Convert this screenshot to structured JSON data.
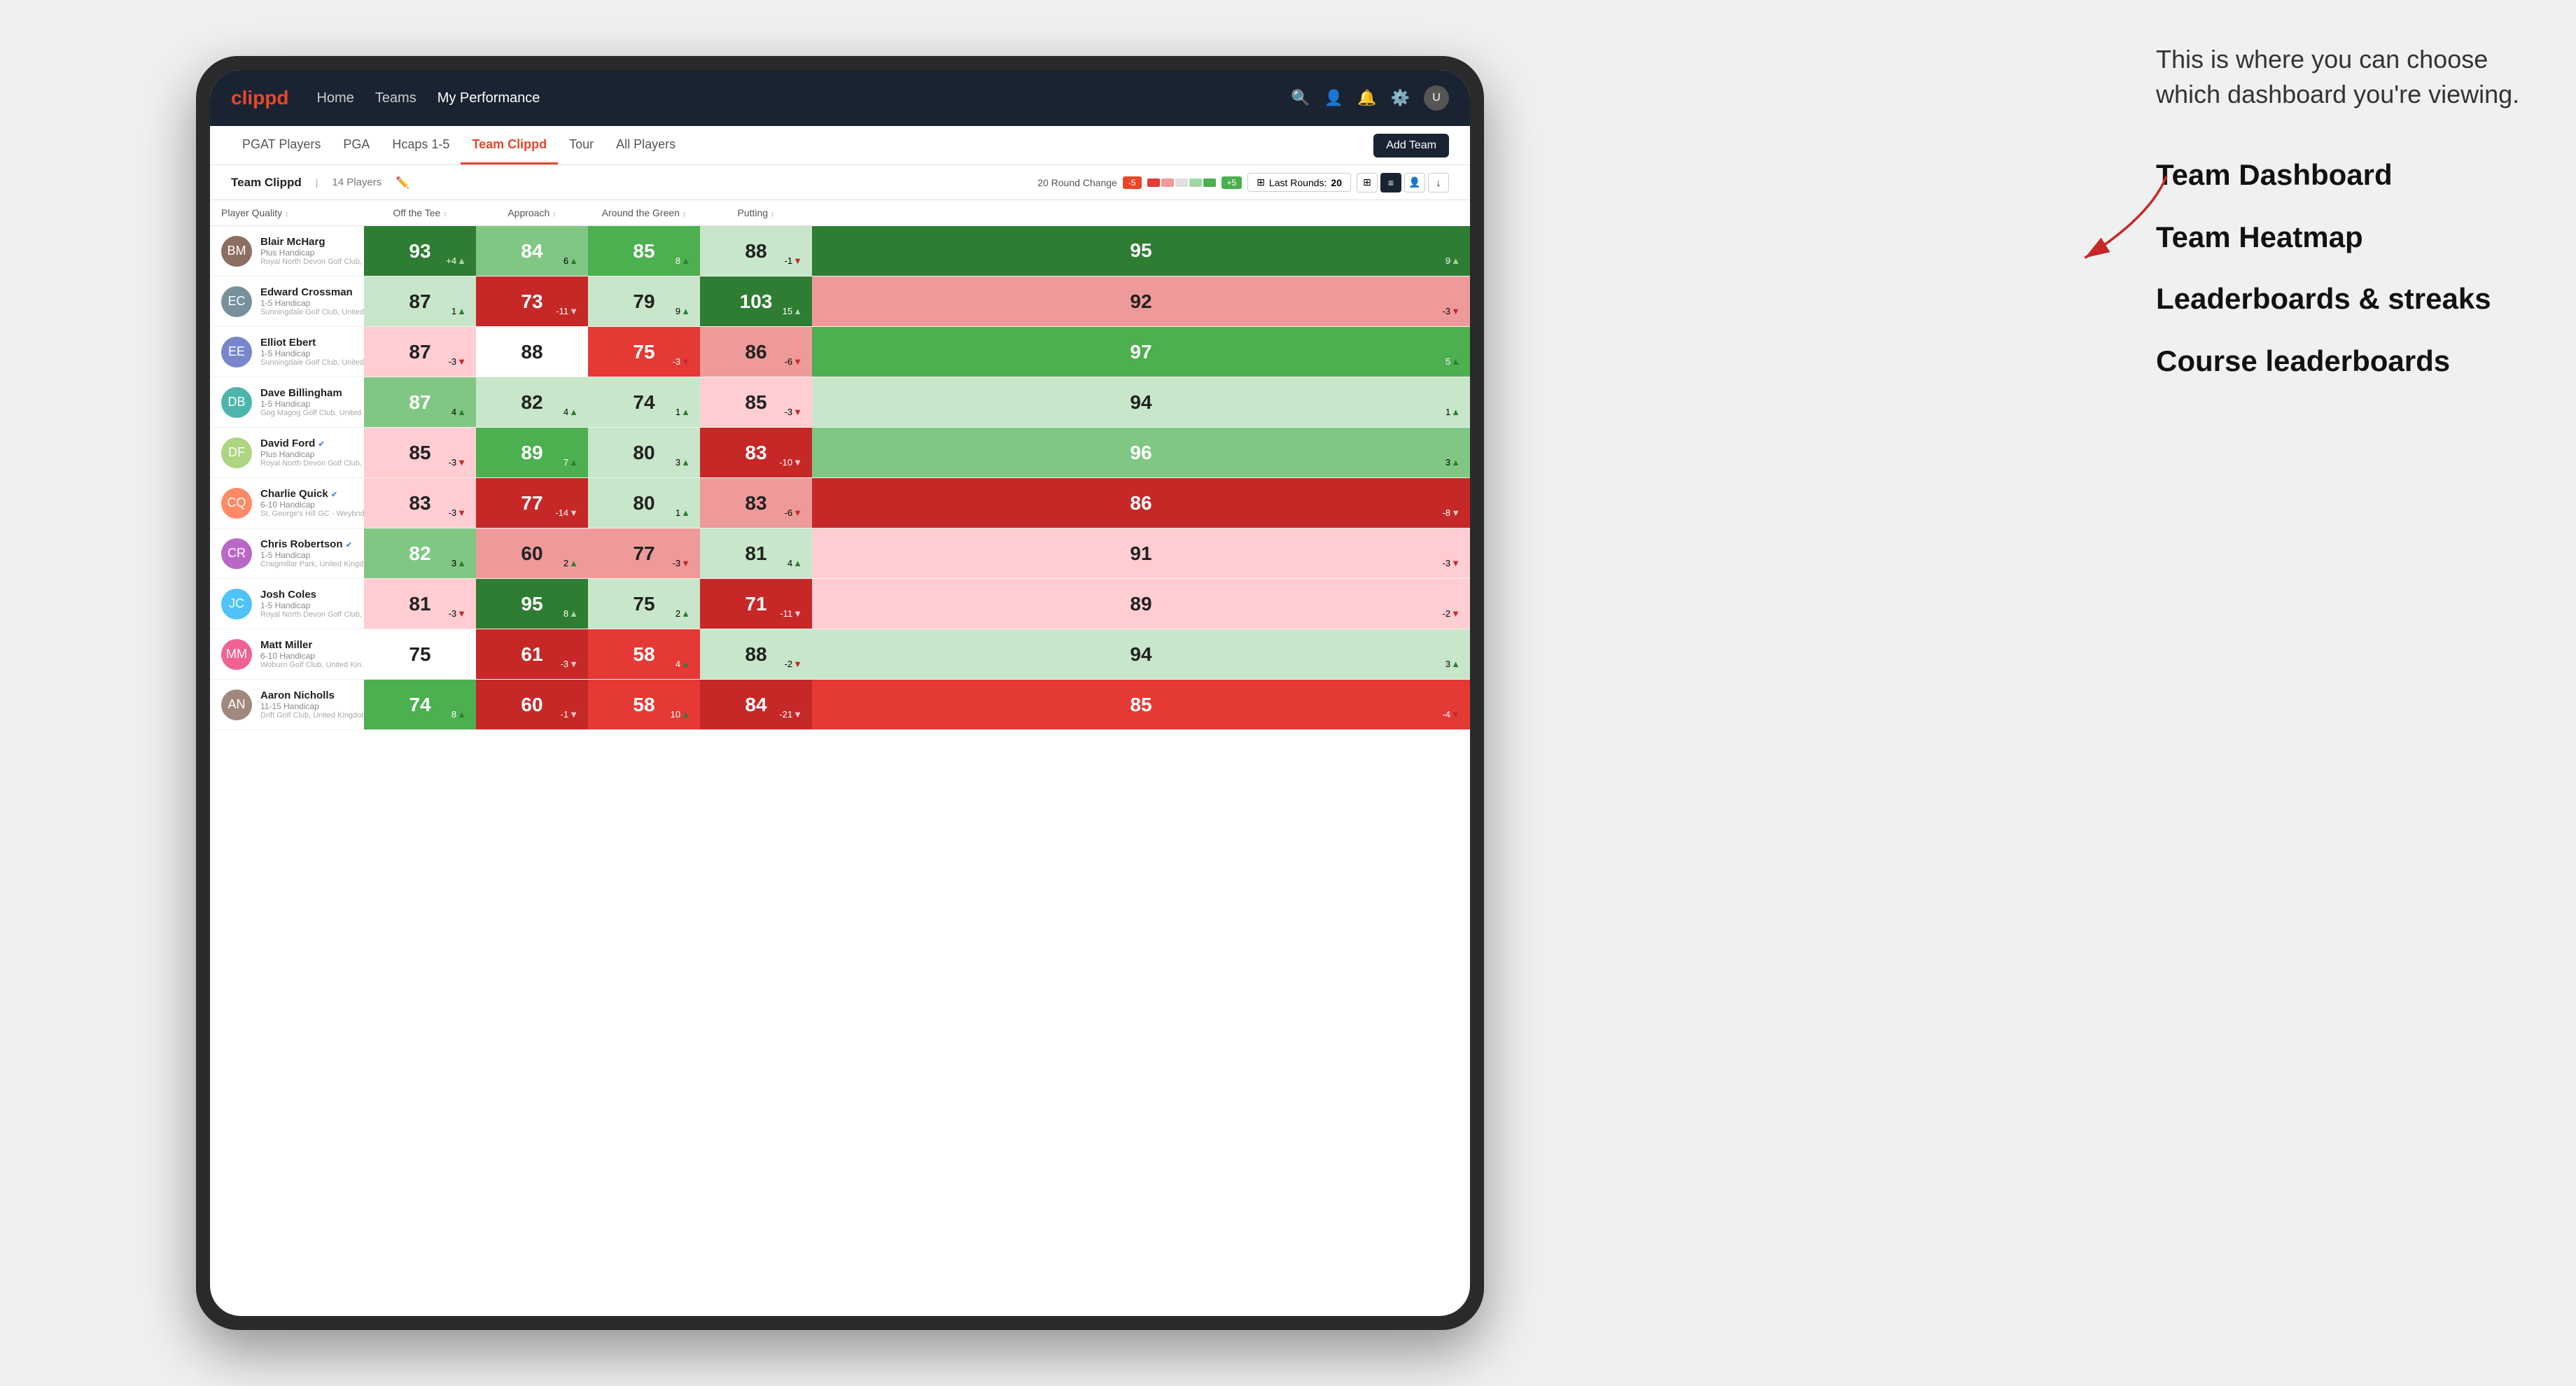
{
  "annotation": {
    "description": "This is where you can choose which dashboard you're viewing.",
    "options": [
      {
        "label": "Team Dashboard"
      },
      {
        "label": "Team Heatmap"
      },
      {
        "label": "Leaderboards & streaks"
      },
      {
        "label": "Course leaderboards"
      }
    ]
  },
  "navbar": {
    "logo": "clippd",
    "links": [
      {
        "label": "Home",
        "active": false
      },
      {
        "label": "Teams",
        "active": false
      },
      {
        "label": "My Performance",
        "active": true
      }
    ]
  },
  "tabs": [
    {
      "label": "PGAT Players",
      "active": false
    },
    {
      "label": "PGA",
      "active": false
    },
    {
      "label": "Hcaps 1-5",
      "active": false
    },
    {
      "label": "Team Clippd",
      "active": true
    },
    {
      "label": "Tour",
      "active": false
    },
    {
      "label": "All Players",
      "active": false
    }
  ],
  "add_team_label": "Add Team",
  "subheader": {
    "team_name": "Team Clippd",
    "player_count": "14 Players",
    "round_change_label": "20 Round Change",
    "change_negative": "-5",
    "change_positive": "+5",
    "last_rounds_label": "Last Rounds:",
    "last_rounds_value": "20"
  },
  "columns": [
    {
      "label": "Player Quality",
      "sort": true
    },
    {
      "label": "Off the Tee",
      "sort": true
    },
    {
      "label": "Approach",
      "sort": true
    },
    {
      "label": "Around the Green",
      "sort": true
    },
    {
      "label": "Putting",
      "sort": true
    }
  ],
  "players": [
    {
      "name": "Blair McHarg",
      "handicap": "Plus Handicap",
      "club": "Royal North Devon Golf Club, United Kingdom",
      "verified": false,
      "scores": [
        {
          "value": 93,
          "change": "+4",
          "direction": "up",
          "color": "bg-green-dark"
        },
        {
          "value": 84,
          "change": "6",
          "direction": "up",
          "color": "bg-green-light"
        },
        {
          "value": 85,
          "change": "8",
          "direction": "up",
          "color": "bg-green-med"
        },
        {
          "value": 88,
          "change": "-1",
          "direction": "down",
          "color": "bg-green-pale"
        },
        {
          "value": 95,
          "change": "9",
          "direction": "up",
          "color": "bg-green-dark"
        }
      ]
    },
    {
      "name": "Edward Crossman",
      "handicap": "1-5 Handicap",
      "club": "Sunningdale Golf Club, United Kingdom",
      "verified": false,
      "scores": [
        {
          "value": 87,
          "change": "1",
          "direction": "up",
          "color": "bg-green-pale"
        },
        {
          "value": 73,
          "change": "-11",
          "direction": "down",
          "color": "bg-red-dark"
        },
        {
          "value": 79,
          "change": "9",
          "direction": "up",
          "color": "bg-green-pale"
        },
        {
          "value": 103,
          "change": "15",
          "direction": "up",
          "color": "bg-green-dark"
        },
        {
          "value": 92,
          "change": "-3",
          "direction": "down",
          "color": "bg-red-light"
        }
      ]
    },
    {
      "name": "Elliot Ebert",
      "handicap": "1-5 Handicap",
      "club": "Sunningdale Golf Club, United Kingdom",
      "verified": false,
      "scores": [
        {
          "value": 87,
          "change": "-3",
          "direction": "down",
          "color": "bg-red-pale"
        },
        {
          "value": 88,
          "change": "",
          "direction": "",
          "color": "bg-white"
        },
        {
          "value": 75,
          "change": "-3",
          "direction": "down",
          "color": "bg-red-med"
        },
        {
          "value": 86,
          "change": "-6",
          "direction": "down",
          "color": "bg-red-light"
        },
        {
          "value": 97,
          "change": "5",
          "direction": "up",
          "color": "bg-green-med"
        }
      ]
    },
    {
      "name": "Dave Billingham",
      "handicap": "1-5 Handicap",
      "club": "Gog Magog Golf Club, United Kingdom",
      "verified": false,
      "scores": [
        {
          "value": 87,
          "change": "4",
          "direction": "up",
          "color": "bg-green-light"
        },
        {
          "value": 82,
          "change": "4",
          "direction": "up",
          "color": "bg-green-pale"
        },
        {
          "value": 74,
          "change": "1",
          "direction": "up",
          "color": "bg-green-pale"
        },
        {
          "value": 85,
          "change": "-3",
          "direction": "down",
          "color": "bg-red-pale"
        },
        {
          "value": 94,
          "change": "1",
          "direction": "up",
          "color": "bg-green-pale"
        }
      ]
    },
    {
      "name": "David Ford",
      "handicap": "Plus Handicap",
      "club": "Royal North Devon Golf Club, United Kingdom",
      "verified": true,
      "scores": [
        {
          "value": 85,
          "change": "-3",
          "direction": "down",
          "color": "bg-red-pale"
        },
        {
          "value": 89,
          "change": "7",
          "direction": "up",
          "color": "bg-green-med"
        },
        {
          "value": 80,
          "change": "3",
          "direction": "up",
          "color": "bg-green-pale"
        },
        {
          "value": 83,
          "change": "-10",
          "direction": "down",
          "color": "bg-red-dark"
        },
        {
          "value": 96,
          "change": "3",
          "direction": "up",
          "color": "bg-green-light"
        }
      ]
    },
    {
      "name": "Charlie Quick",
      "handicap": "6-10 Handicap",
      "club": "St. George's Hill GC - Weybridge - Surrey, Uni...",
      "verified": true,
      "scores": [
        {
          "value": 83,
          "change": "-3",
          "direction": "down",
          "color": "bg-red-pale"
        },
        {
          "value": 77,
          "change": "-14",
          "direction": "down",
          "color": "bg-red-dark"
        },
        {
          "value": 80,
          "change": "1",
          "direction": "up",
          "color": "bg-green-pale"
        },
        {
          "value": 83,
          "change": "-6",
          "direction": "down",
          "color": "bg-red-light"
        },
        {
          "value": 86,
          "change": "-8",
          "direction": "down",
          "color": "bg-red-dark"
        }
      ]
    },
    {
      "name": "Chris Robertson",
      "handicap": "1-5 Handicap",
      "club": "Craigmillar Park, United Kingdom",
      "verified": true,
      "scores": [
        {
          "value": 82,
          "change": "3",
          "direction": "up",
          "color": "bg-green-light"
        },
        {
          "value": 60,
          "change": "2",
          "direction": "up",
          "color": "bg-red-light"
        },
        {
          "value": 77,
          "change": "-3",
          "direction": "down",
          "color": "bg-red-light"
        },
        {
          "value": 81,
          "change": "4",
          "direction": "up",
          "color": "bg-green-pale"
        },
        {
          "value": 91,
          "change": "-3",
          "direction": "down",
          "color": "bg-red-pale"
        }
      ]
    },
    {
      "name": "Josh Coles",
      "handicap": "1-5 Handicap",
      "club": "Royal North Devon Golf Club, United Kingdom",
      "verified": false,
      "scores": [
        {
          "value": 81,
          "change": "-3",
          "direction": "down",
          "color": "bg-red-pale"
        },
        {
          "value": 95,
          "change": "8",
          "direction": "up",
          "color": "bg-green-dark"
        },
        {
          "value": 75,
          "change": "2",
          "direction": "up",
          "color": "bg-green-pale"
        },
        {
          "value": 71,
          "change": "-11",
          "direction": "down",
          "color": "bg-red-dark"
        },
        {
          "value": 89,
          "change": "-2",
          "direction": "down",
          "color": "bg-red-pale"
        }
      ]
    },
    {
      "name": "Matt Miller",
      "handicap": "6-10 Handicap",
      "club": "Woburn Golf Club, United Kingdom",
      "verified": false,
      "scores": [
        {
          "value": 75,
          "change": "",
          "direction": "",
          "color": "bg-white"
        },
        {
          "value": 61,
          "change": "-3",
          "direction": "down",
          "color": "bg-red-dark"
        },
        {
          "value": 58,
          "change": "4",
          "direction": "up",
          "color": "bg-red-med"
        },
        {
          "value": 88,
          "change": "-2",
          "direction": "down",
          "color": "bg-green-pale"
        },
        {
          "value": 94,
          "change": "3",
          "direction": "up",
          "color": "bg-green-pale"
        }
      ]
    },
    {
      "name": "Aaron Nicholls",
      "handicap": "11-15 Handicap",
      "club": "Drift Golf Club, United Kingdom",
      "verified": false,
      "scores": [
        {
          "value": 74,
          "change": "8",
          "direction": "up",
          "color": "bg-green-med"
        },
        {
          "value": 60,
          "change": "-1",
          "direction": "down",
          "color": "bg-red-dark"
        },
        {
          "value": 58,
          "change": "10",
          "direction": "up",
          "color": "bg-red-med"
        },
        {
          "value": 84,
          "change": "-21",
          "direction": "down",
          "color": "bg-red-dark"
        },
        {
          "value": 85,
          "change": "-4",
          "direction": "down",
          "color": "bg-red-med"
        }
      ]
    }
  ]
}
